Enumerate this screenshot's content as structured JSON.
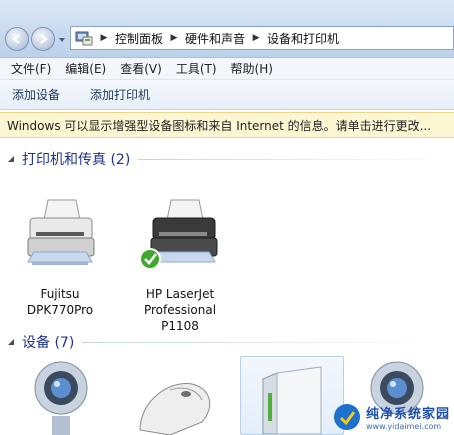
{
  "address": {
    "crumbs": [
      "控制面板",
      "硬件和声音",
      "设备和打印机"
    ]
  },
  "menu": {
    "items": [
      "文件(F)",
      "编辑(E)",
      "查看(V)",
      "工具(T)",
      "帮助(H)"
    ]
  },
  "toolbar": {
    "add_device": "添加设备",
    "add_printer": "添加打印机"
  },
  "infobar": {
    "text": "Windows 可以显示增强型设备图标和来自 Internet 的信息。请单击进行更改..."
  },
  "groups": {
    "printers": {
      "title": "打印机和传真 (2)"
    },
    "devices": {
      "title": "设备 (7)"
    }
  },
  "printers": [
    {
      "label_lines": [
        "Fujitsu",
        "DPK770Pro"
      ],
      "default": false
    },
    {
      "label_lines": [
        "HP LaserJet",
        "Professional",
        "P1108"
      ],
      "default": true
    }
  ],
  "bottom_devices": [
    "webcam-icon",
    "mouse-icon",
    "external-drive-icon",
    "webcam-icon"
  ],
  "watermark": {
    "name": "纯净系统家园",
    "url": "www.yidaimei.com"
  },
  "colors": {
    "group_title": "#1e3287",
    "infobar_bg": "#fdf6d2",
    "default_check": "#3ea82c"
  }
}
